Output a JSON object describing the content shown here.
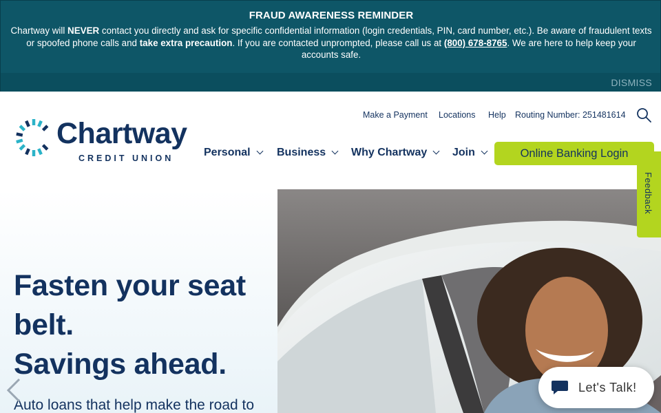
{
  "alert": {
    "title": "FRAUD AWARENESS REMINDER",
    "body_1": "Chartway will ",
    "body_never": "NEVER",
    "body_2": " contact you directly and ask for specific confidential information (login credentials, PIN, card number, etc.). Be aware of fraudulent texts or spoofed phone calls and ",
    "body_precaution": "take extra precaution",
    "body_3": ". If you are contacted unprompted, please call us at ",
    "phone": "(800) 678-8765",
    "body_4": ". We are here to help keep your accounts safe.",
    "dismiss": "DISMISS"
  },
  "logo": {
    "wordmark": "Chartway",
    "subtitle": "CREDIT UNION"
  },
  "utility_nav": {
    "make_payment": "Make a Payment",
    "locations": "Locations",
    "help": "Help",
    "routing": "Routing Number: 251481614"
  },
  "main_nav": {
    "personal": "Personal",
    "business": "Business",
    "why": "Why Chartway",
    "join": "Join",
    "login": "Online Banking Login"
  },
  "feedback": "Feedback",
  "hero": {
    "title_1": "Fasten your seat",
    "title_2": "belt.",
    "title_3": "Savings ahead.",
    "subtitle": "Auto loans that help make the road to"
  },
  "chat": {
    "label": "Let's Talk!"
  },
  "colors": {
    "alert_bg": "#0e5667",
    "brand_navy": "#13325f",
    "accent_green": "#b3d51f",
    "logo_teal": "#2bb3c8"
  },
  "icons": {
    "search": "search-icon",
    "chevron": "chevron-down-icon",
    "prev": "chevron-left-icon",
    "chat": "chat-bubble-icon"
  }
}
